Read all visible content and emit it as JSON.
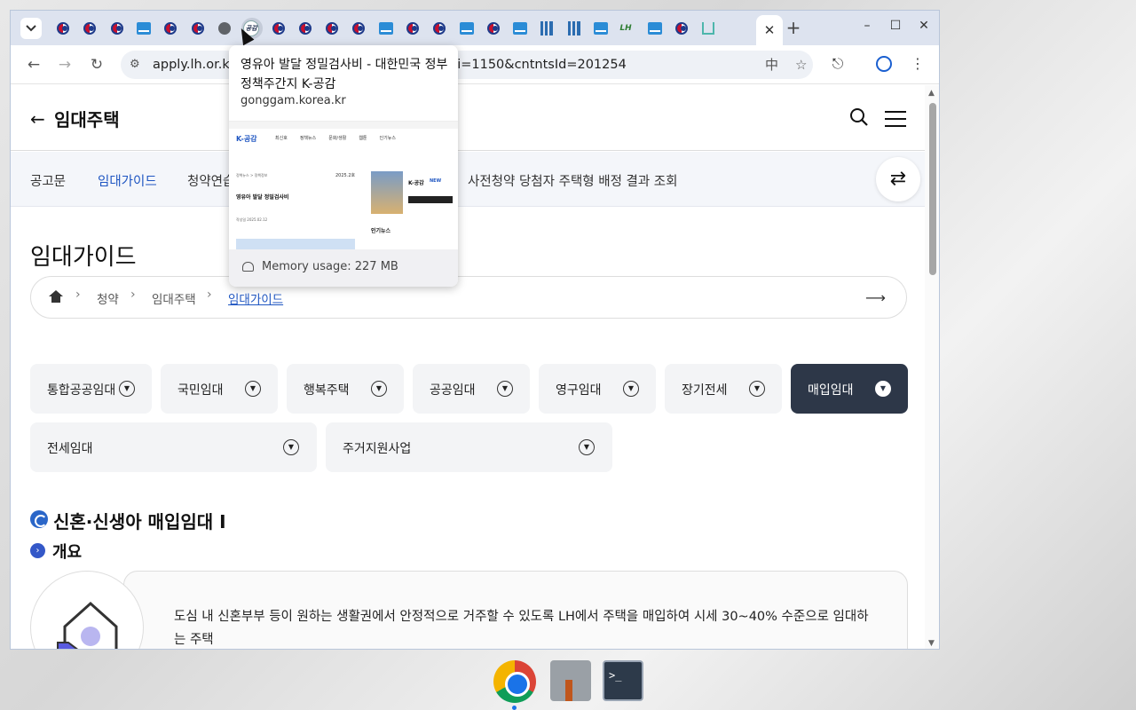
{
  "browser": {
    "tab_count_shown": 26,
    "active_tab_close": "✕",
    "new_tab": "+",
    "url_visible_start": "apply.lh.or.k",
    "url_visible_end": "ni=1150&cntntsId=201254",
    "window_controls": {
      "minimize": "–",
      "maximize": "☐",
      "close": "✕"
    }
  },
  "hovercard": {
    "title": "영유아 발달 정밀검사비 - 대한민국 정부 정책주간지 K-공감",
    "domain": "gonggam.korea.kr",
    "memory": "Memory usage: 227 MB",
    "thumb": {
      "logo": "K-공감",
      "nav": [
        "최신호",
        "정책뉴스",
        "문화/생활",
        "웹툰",
        "인기뉴스"
      ],
      "breadcrumb": "정책뉴스 > 정책정보",
      "date": "2025.2호",
      "headline": "영유아 발달 정밀검사비",
      "meta": "작성일 2025.02.12",
      "badge": "K-공감",
      "badge_new": "NEW",
      "side_title": "인기뉴스"
    }
  },
  "page": {
    "header_title": "임대주택",
    "subnav": [
      "공고문",
      "임대가이드",
      "청약연습",
      "사전청약 당첨자 주택형 배정 결과 조회"
    ],
    "subnav_active": "임대가이드",
    "heading": "임대가이드",
    "breadcrumb": [
      "청약",
      "임대주택",
      "임대가이드"
    ],
    "categories": [
      "통합공공임대",
      "국민임대",
      "행복주택",
      "공공임대",
      "영구임대",
      "장기전세",
      "매입임대",
      "전세임대",
      "주거지원사업"
    ],
    "selected_category": "매입임대",
    "section_title": "신혼·신생아 매입임대 Ⅰ",
    "sub_title": "개요",
    "description": "도심 내 신혼부부 등이 원하는 생활권에서 안정적으로 거주할 수 있도록 LH에서 주택을 매입하여 시세 30~40% 수준으로 임대하는 주택"
  },
  "colors": {
    "accent": "#1f56c2",
    "selected_bg": "#2d3748",
    "tabstrip": "#dde3ef"
  },
  "dock": [
    "chrome-icon",
    "mail-app-icon",
    "terminal-icon"
  ]
}
